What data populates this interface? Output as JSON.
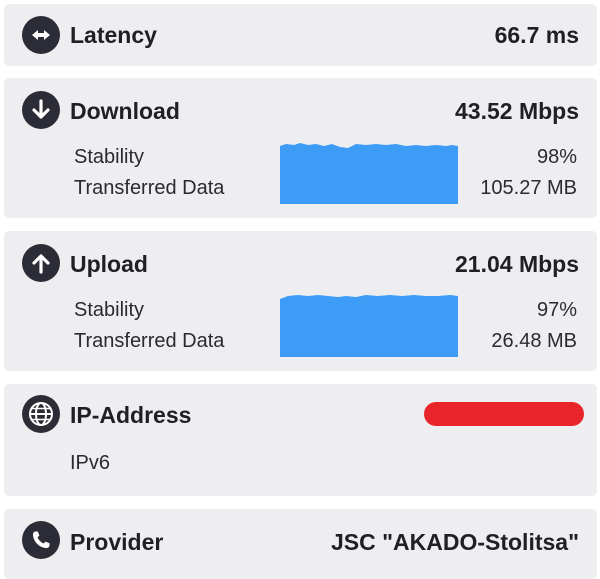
{
  "latency": {
    "title": "Latency",
    "value": "66.7 ms",
    "icon": "arrows-horizontal-icon"
  },
  "download": {
    "title": "Download",
    "value": "43.52 Mbps",
    "icon": "arrow-down-circle-icon",
    "stability_label": "Stability",
    "stability_value": "98%",
    "stability_level": 0.98,
    "transferred_label": "Transferred Data",
    "transferred_value": "105.27 MB"
  },
  "upload": {
    "title": "Upload",
    "value": "21.04 Mbps",
    "icon": "arrow-up-circle-icon",
    "stability_label": "Stability",
    "stability_value": "97%",
    "stability_level": 0.97,
    "transferred_label": "Transferred Data",
    "transferred_value": "26.48 MB"
  },
  "ip": {
    "title": "IP-Address",
    "version": "IPv6",
    "icon": "globe-icon"
  },
  "provider": {
    "title": "Provider",
    "value": "JSC \"AKADO-Stolitsa\"",
    "icon": "phone-icon"
  },
  "colors": {
    "card_bg": "#eeeef1",
    "icon_bg": "#2c2c36",
    "graph": "#3d9cf5",
    "redaction": "#e8252a"
  }
}
